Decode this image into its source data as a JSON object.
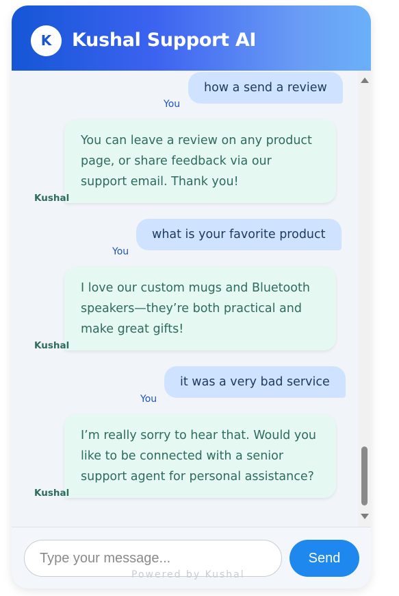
{
  "header": {
    "avatar_letter": "K",
    "title": "Kushal Support AI"
  },
  "messages": [
    {
      "role": "user",
      "sender": "You",
      "text": "how a send a review"
    },
    {
      "role": "bot",
      "sender": "Kushal",
      "lines": [
        "You can leave a review on any product",
        "page, or share feedback via our",
        "support email. Thank you!"
      ]
    },
    {
      "role": "user",
      "sender": "You",
      "text": "what is your favorite product"
    },
    {
      "role": "bot",
      "sender": "Kushal",
      "lines": [
        "I love our custom mugs and Bluetooth",
        "speakers—they’re both practical and",
        "make great gifts!"
      ]
    },
    {
      "role": "user",
      "sender": "You",
      "text": "it was a very bad service"
    },
    {
      "role": "bot",
      "sender": "Kushal",
      "lines": [
        "I’m really sorry to hear that. Would you",
        "like to be connected with a senior",
        "support agent for personal assistance?"
      ]
    }
  ],
  "composer": {
    "placeholder": "Type your message...",
    "value": "",
    "send_label": "Send",
    "powered_by": "Powered by Kushal"
  },
  "colors": {
    "header_gradient_start": "#1556d6",
    "header_gradient_end": "#6bb0f8",
    "user_bubble": "#cfe2ff",
    "bot_bubble": "#e5f8f1",
    "send_button": "#1e88ef"
  }
}
